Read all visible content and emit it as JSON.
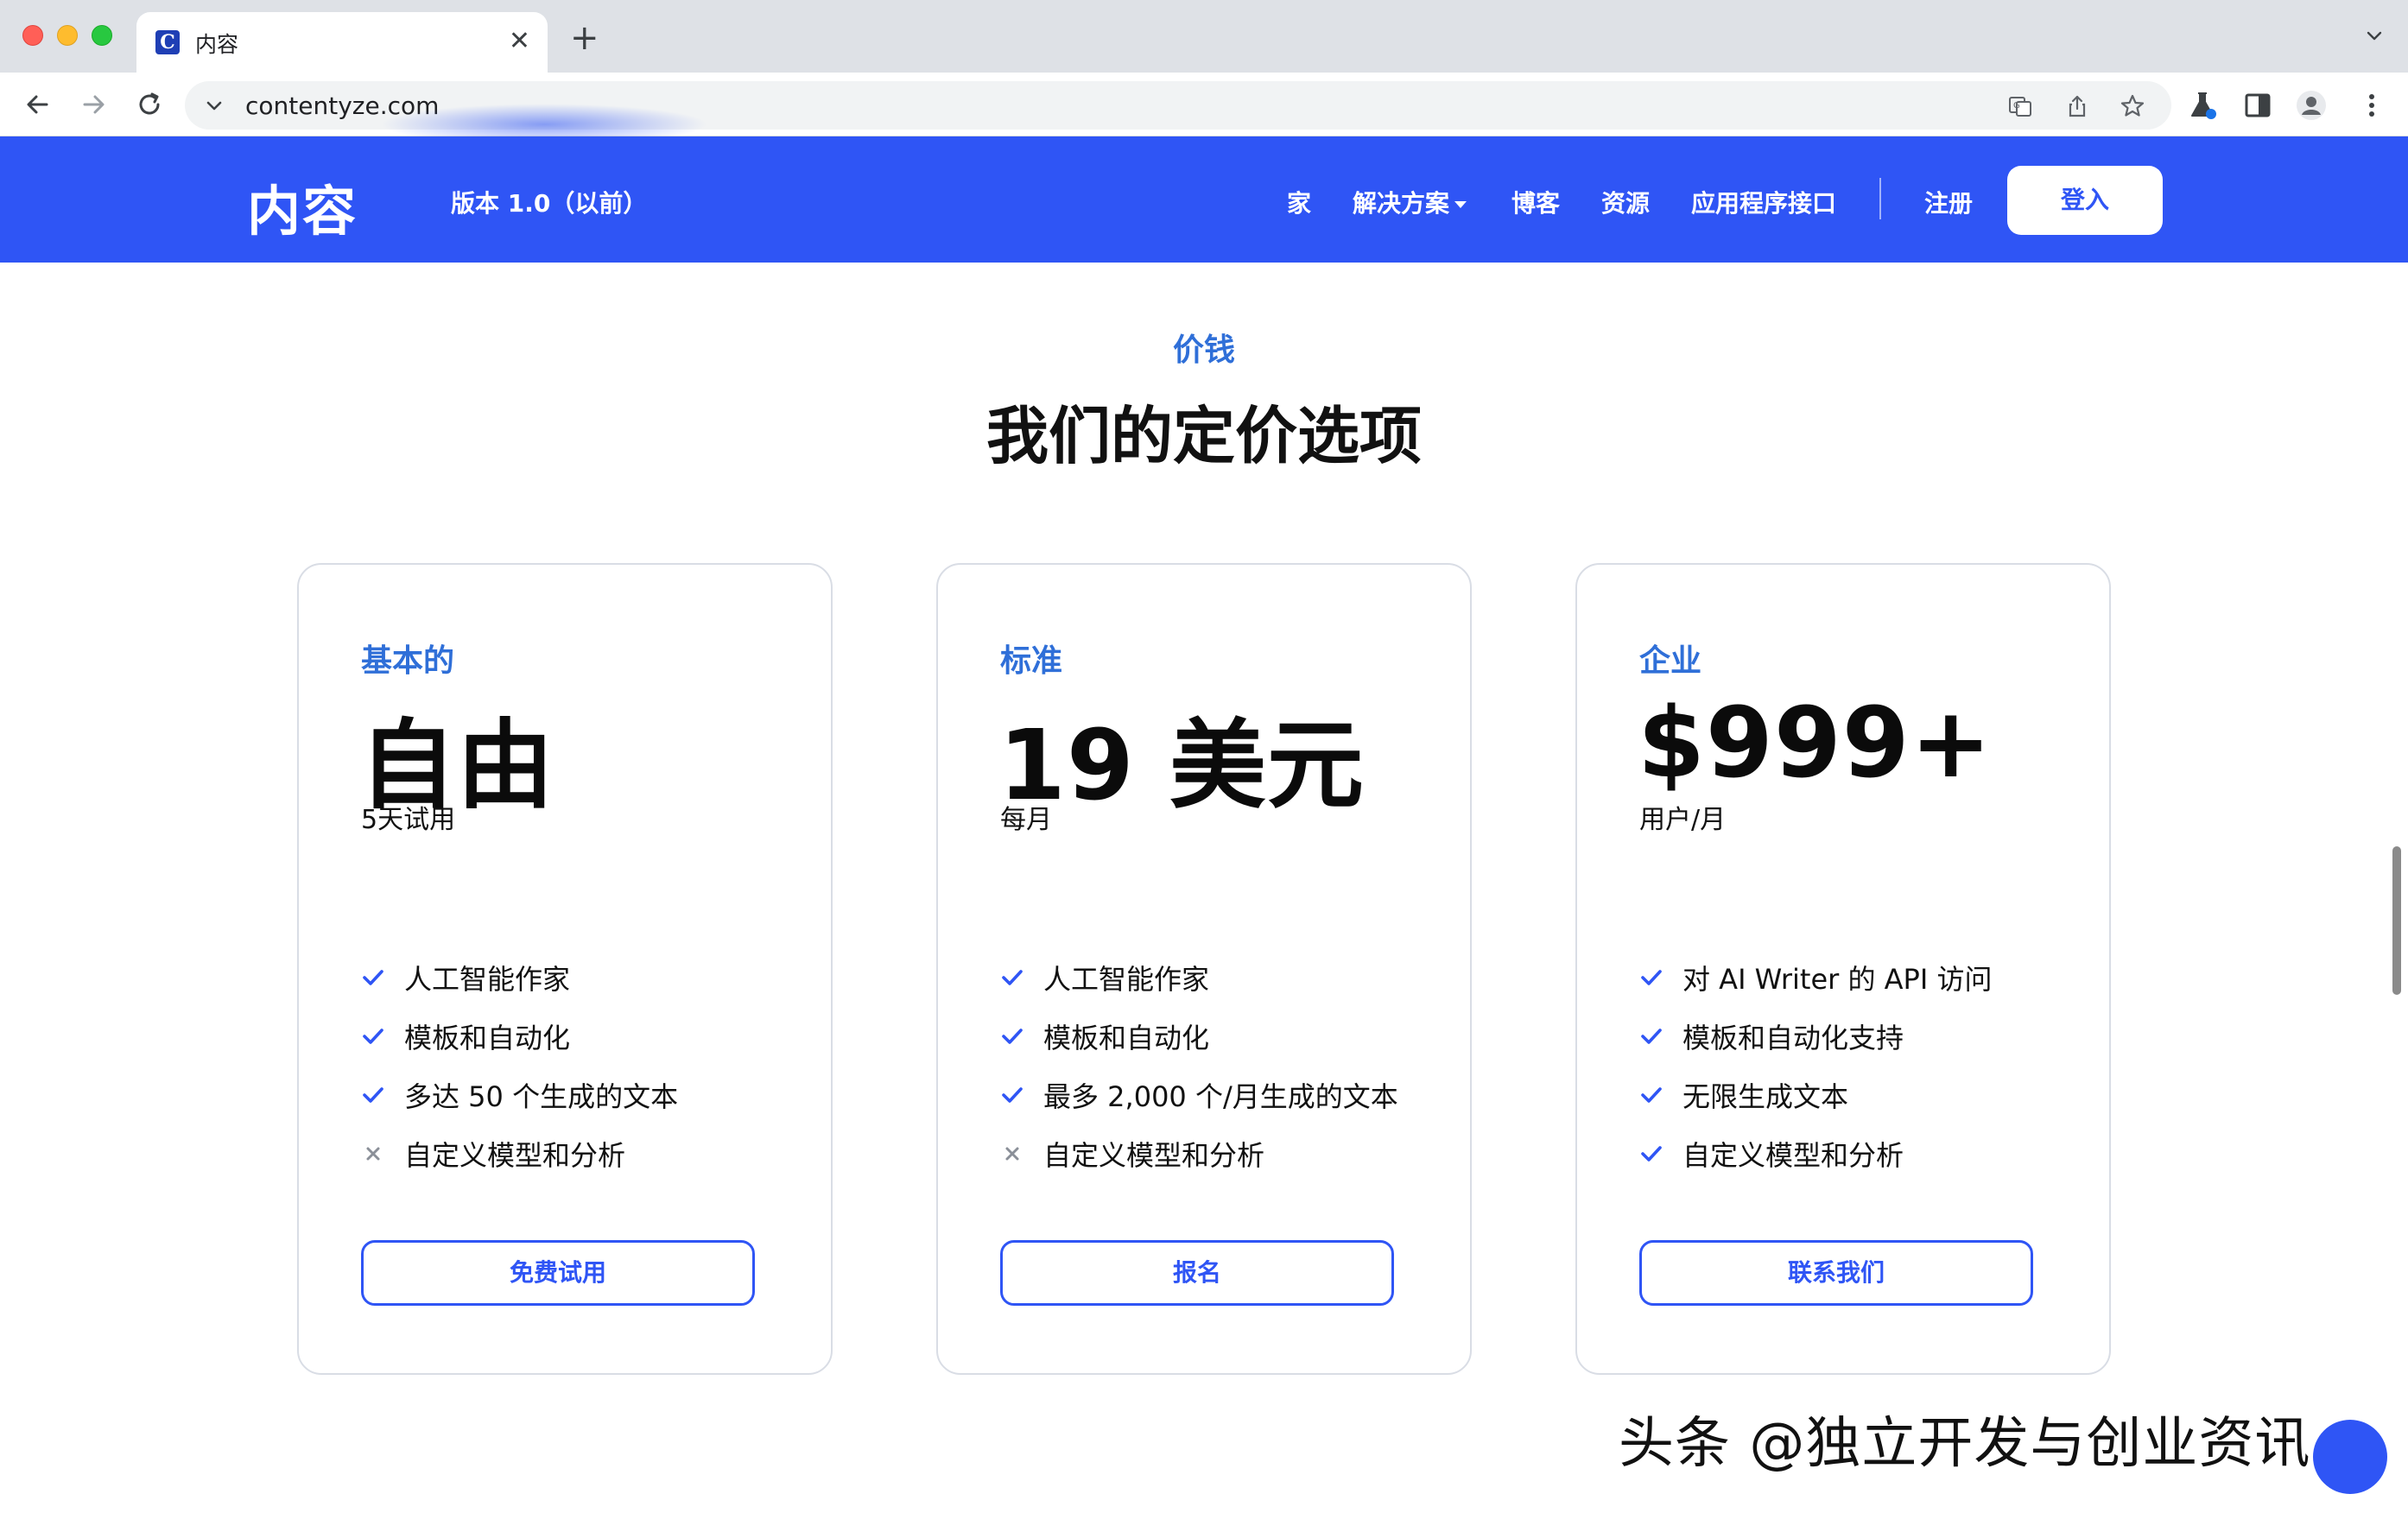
{
  "browser": {
    "tab_title": "内容",
    "favicon_letter": "C",
    "url": "contentyze.com",
    "icons": [
      "back-icon",
      "forward-icon",
      "reload-icon",
      "site-info-icon",
      "translate-icon",
      "share-icon",
      "bookmark-star-icon",
      "labs-flask-icon",
      "side-panel-icon",
      "profile-icon",
      "kebab-menu-icon",
      "tab-close-icon",
      "new-tab-icon",
      "tab-search-icon"
    ]
  },
  "header": {
    "logo": "内容",
    "version": "版本 1.0（以前）",
    "nav": {
      "home": "家",
      "solutions": "解决方案",
      "blog": "博客",
      "resources": "资源",
      "api": "应用程序接口",
      "register": "注册",
      "login": "登入"
    },
    "brand_color": "#2f55f5"
  },
  "pricing": {
    "eyebrow": "价钱",
    "title": "我们的定价选项",
    "accent_color": "#2f6fd8",
    "plans": [
      {
        "name": "基本的",
        "price": "自由",
        "period": "5天试用",
        "features": [
          {
            "text": "人工智能作家",
            "included": true
          },
          {
            "text": "模板和自动化",
            "included": true
          },
          {
            "text": "多达 50 个生成的文本",
            "included": true
          },
          {
            "text": "自定义模型和分析",
            "included": false
          }
        ],
        "cta": "免费试用"
      },
      {
        "name": "标准",
        "price": "19 美元",
        "period": "每月",
        "features": [
          {
            "text": "人工智能作家",
            "included": true
          },
          {
            "text": "模板和自动化",
            "included": true
          },
          {
            "text": "最多 2,000 个/月生成的文本",
            "included": true
          },
          {
            "text": "自定义模型和分析",
            "included": false
          }
        ],
        "cta": "报名"
      },
      {
        "name": "企业",
        "price": "$999+",
        "period": "用户/月",
        "features": [
          {
            "text": "对 AI Writer 的 API 访问",
            "included": true
          },
          {
            "text": "模板和自动化支持",
            "included": true
          },
          {
            "text": "无限生成文本",
            "included": true
          },
          {
            "text": "自定义模型和分析",
            "included": true
          }
        ],
        "cta": "联系我们"
      }
    ]
  },
  "watermark": "头条 @独立开发与创业资讯"
}
